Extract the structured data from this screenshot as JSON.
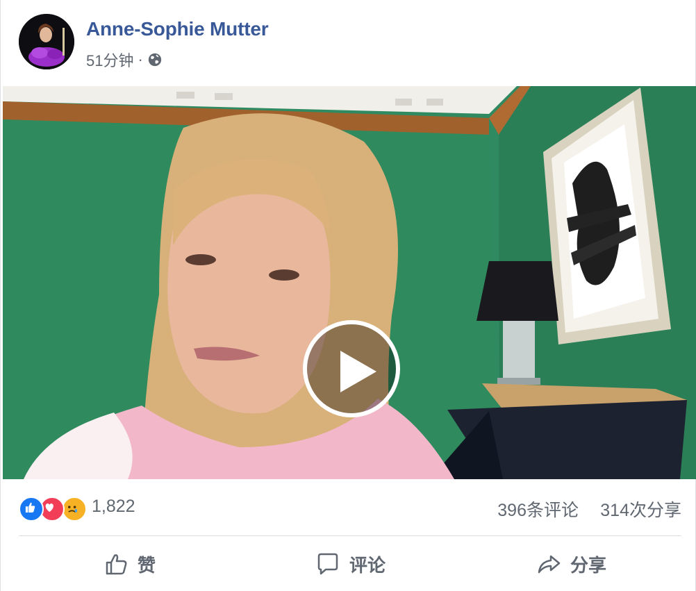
{
  "post": {
    "author": "Anne-Sophie Mutter",
    "timestamp": "51分钟",
    "separator": "·",
    "privacy_icon": "globe-icon"
  },
  "video": {
    "play_icon": "play-icon"
  },
  "reactions": {
    "icons": [
      "like-icon",
      "love-icon",
      "sad-icon"
    ],
    "count": "1,822",
    "comments": "396条评论",
    "shares": "314次分享"
  },
  "actions": {
    "like_label": "赞",
    "comment_label": "评论",
    "share_label": "分享"
  },
  "colors": {
    "author_link": "#385898",
    "secondary_text": "#606770",
    "like_blue": "#1877f2",
    "love_red": "#f33e58",
    "sad_yellow": "#f7b125"
  }
}
